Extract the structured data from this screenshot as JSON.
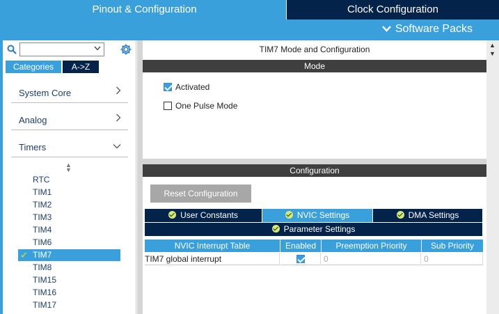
{
  "header": {
    "tabs": [
      {
        "label": "Pinout & Configuration",
        "active": true
      },
      {
        "label": "Clock Configuration",
        "active": false
      }
    ],
    "software_packs_label": "Software Packs"
  },
  "left": {
    "search": {
      "value": "",
      "placeholder": ""
    },
    "tabs": [
      {
        "label": "Categories",
        "active": true
      },
      {
        "label": "A->Z",
        "active": false
      }
    ],
    "categories": [
      {
        "label": "System Core",
        "expanded": false
      },
      {
        "label": "Analog",
        "expanded": false
      },
      {
        "label": "Timers",
        "expanded": true
      }
    ],
    "timers": [
      {
        "label": "RTC",
        "selected": false
      },
      {
        "label": "TIM1",
        "selected": false
      },
      {
        "label": "TIM2",
        "selected": false
      },
      {
        "label": "TIM3",
        "selected": false
      },
      {
        "label": "TIM4",
        "selected": false
      },
      {
        "label": "TIM6",
        "selected": false
      },
      {
        "label": "TIM7",
        "selected": true
      },
      {
        "label": "TIM8",
        "selected": false
      },
      {
        "label": "TIM15",
        "selected": false
      },
      {
        "label": "TIM16",
        "selected": false
      },
      {
        "label": "TIM17",
        "selected": false
      }
    ]
  },
  "mode_panel": {
    "title": "TIM7 Mode and Configuration",
    "section": "Mode",
    "options": [
      {
        "label": "Activated",
        "checked": true
      },
      {
        "label": "One Pulse Mode",
        "checked": false
      }
    ]
  },
  "config_panel": {
    "section": "Configuration",
    "reset_label": "Reset Configuration",
    "tabs": [
      {
        "label": "User Constants",
        "active": false
      },
      {
        "label": "NVIC Settings",
        "active": true
      },
      {
        "label": "DMA Settings",
        "active": false
      },
      {
        "label": "Parameter Settings",
        "active": false
      }
    ],
    "table": {
      "headers": [
        "NVIC Interrupt Table",
        "Enabled",
        "Preemption Priority",
        "Sub Priority"
      ],
      "rows": [
        {
          "name": "TIM7 global interrupt",
          "enabled": true,
          "preemption": "0",
          "sub": "0"
        }
      ]
    }
  },
  "colors": {
    "accent": "#3aa0dc",
    "dark": "#03234b",
    "section": "#3f3f3f"
  },
  "icons": [
    "search-icon",
    "gear-icon",
    "chevron-right-icon",
    "chevron-down-icon",
    "check-icon"
  ]
}
